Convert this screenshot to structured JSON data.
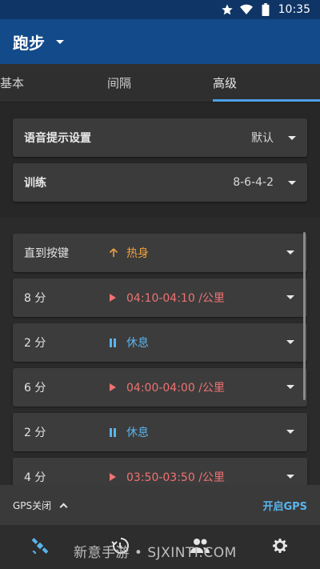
{
  "status_bar": {
    "time": "10:35",
    "icons": [
      "star-icon",
      "wifi-icon",
      "battery-icon"
    ]
  },
  "app_bar": {
    "title": "跑步"
  },
  "tabs": [
    {
      "label": "基本"
    },
    {
      "label": "间隔"
    },
    {
      "label": "高级",
      "active": true
    }
  ],
  "settings": {
    "voice_prompt": {
      "label": "语音提示设置",
      "value": "默认"
    },
    "workout": {
      "label": "训练",
      "value": "8-6-4-2"
    }
  },
  "steps": [
    {
      "name": "直到按键",
      "icon": "arrow-up-icon",
      "target": "热身",
      "color": "#f0a040"
    },
    {
      "name": "8 分",
      "icon": "play-icon",
      "target": "04:10-04:10 /公里",
      "color": "#f07272"
    },
    {
      "name": "2 分",
      "icon": "pause-icon",
      "target": "休息",
      "color": "#5ab4ec"
    },
    {
      "name": "6 分",
      "icon": "play-icon",
      "target": "04:00-04:00 /公里",
      "color": "#f07272"
    },
    {
      "name": "2 分",
      "icon": "pause-icon",
      "target": "休息",
      "color": "#5ab4ec"
    },
    {
      "name": "4 分",
      "icon": "play-icon",
      "target": "03:50-03:50 /公里",
      "color": "#f07272"
    }
  ],
  "gps": {
    "status": "GPS关闭",
    "action": "开启GPS"
  },
  "bottom_nav": [
    {
      "icon": "satellite-icon",
      "active": true
    },
    {
      "icon": "history-icon"
    },
    {
      "icon": "people-icon"
    },
    {
      "icon": "settings-icon"
    }
  ],
  "watermark": "新意手游 • SJXINTI.COM",
  "colors": {
    "app_bar": "#124a8a",
    "status_bar": "#0f3566",
    "accent": "#4ea1e8",
    "warmup": "#f0a040",
    "run": "#f07272",
    "rest": "#5ab4ec"
  }
}
